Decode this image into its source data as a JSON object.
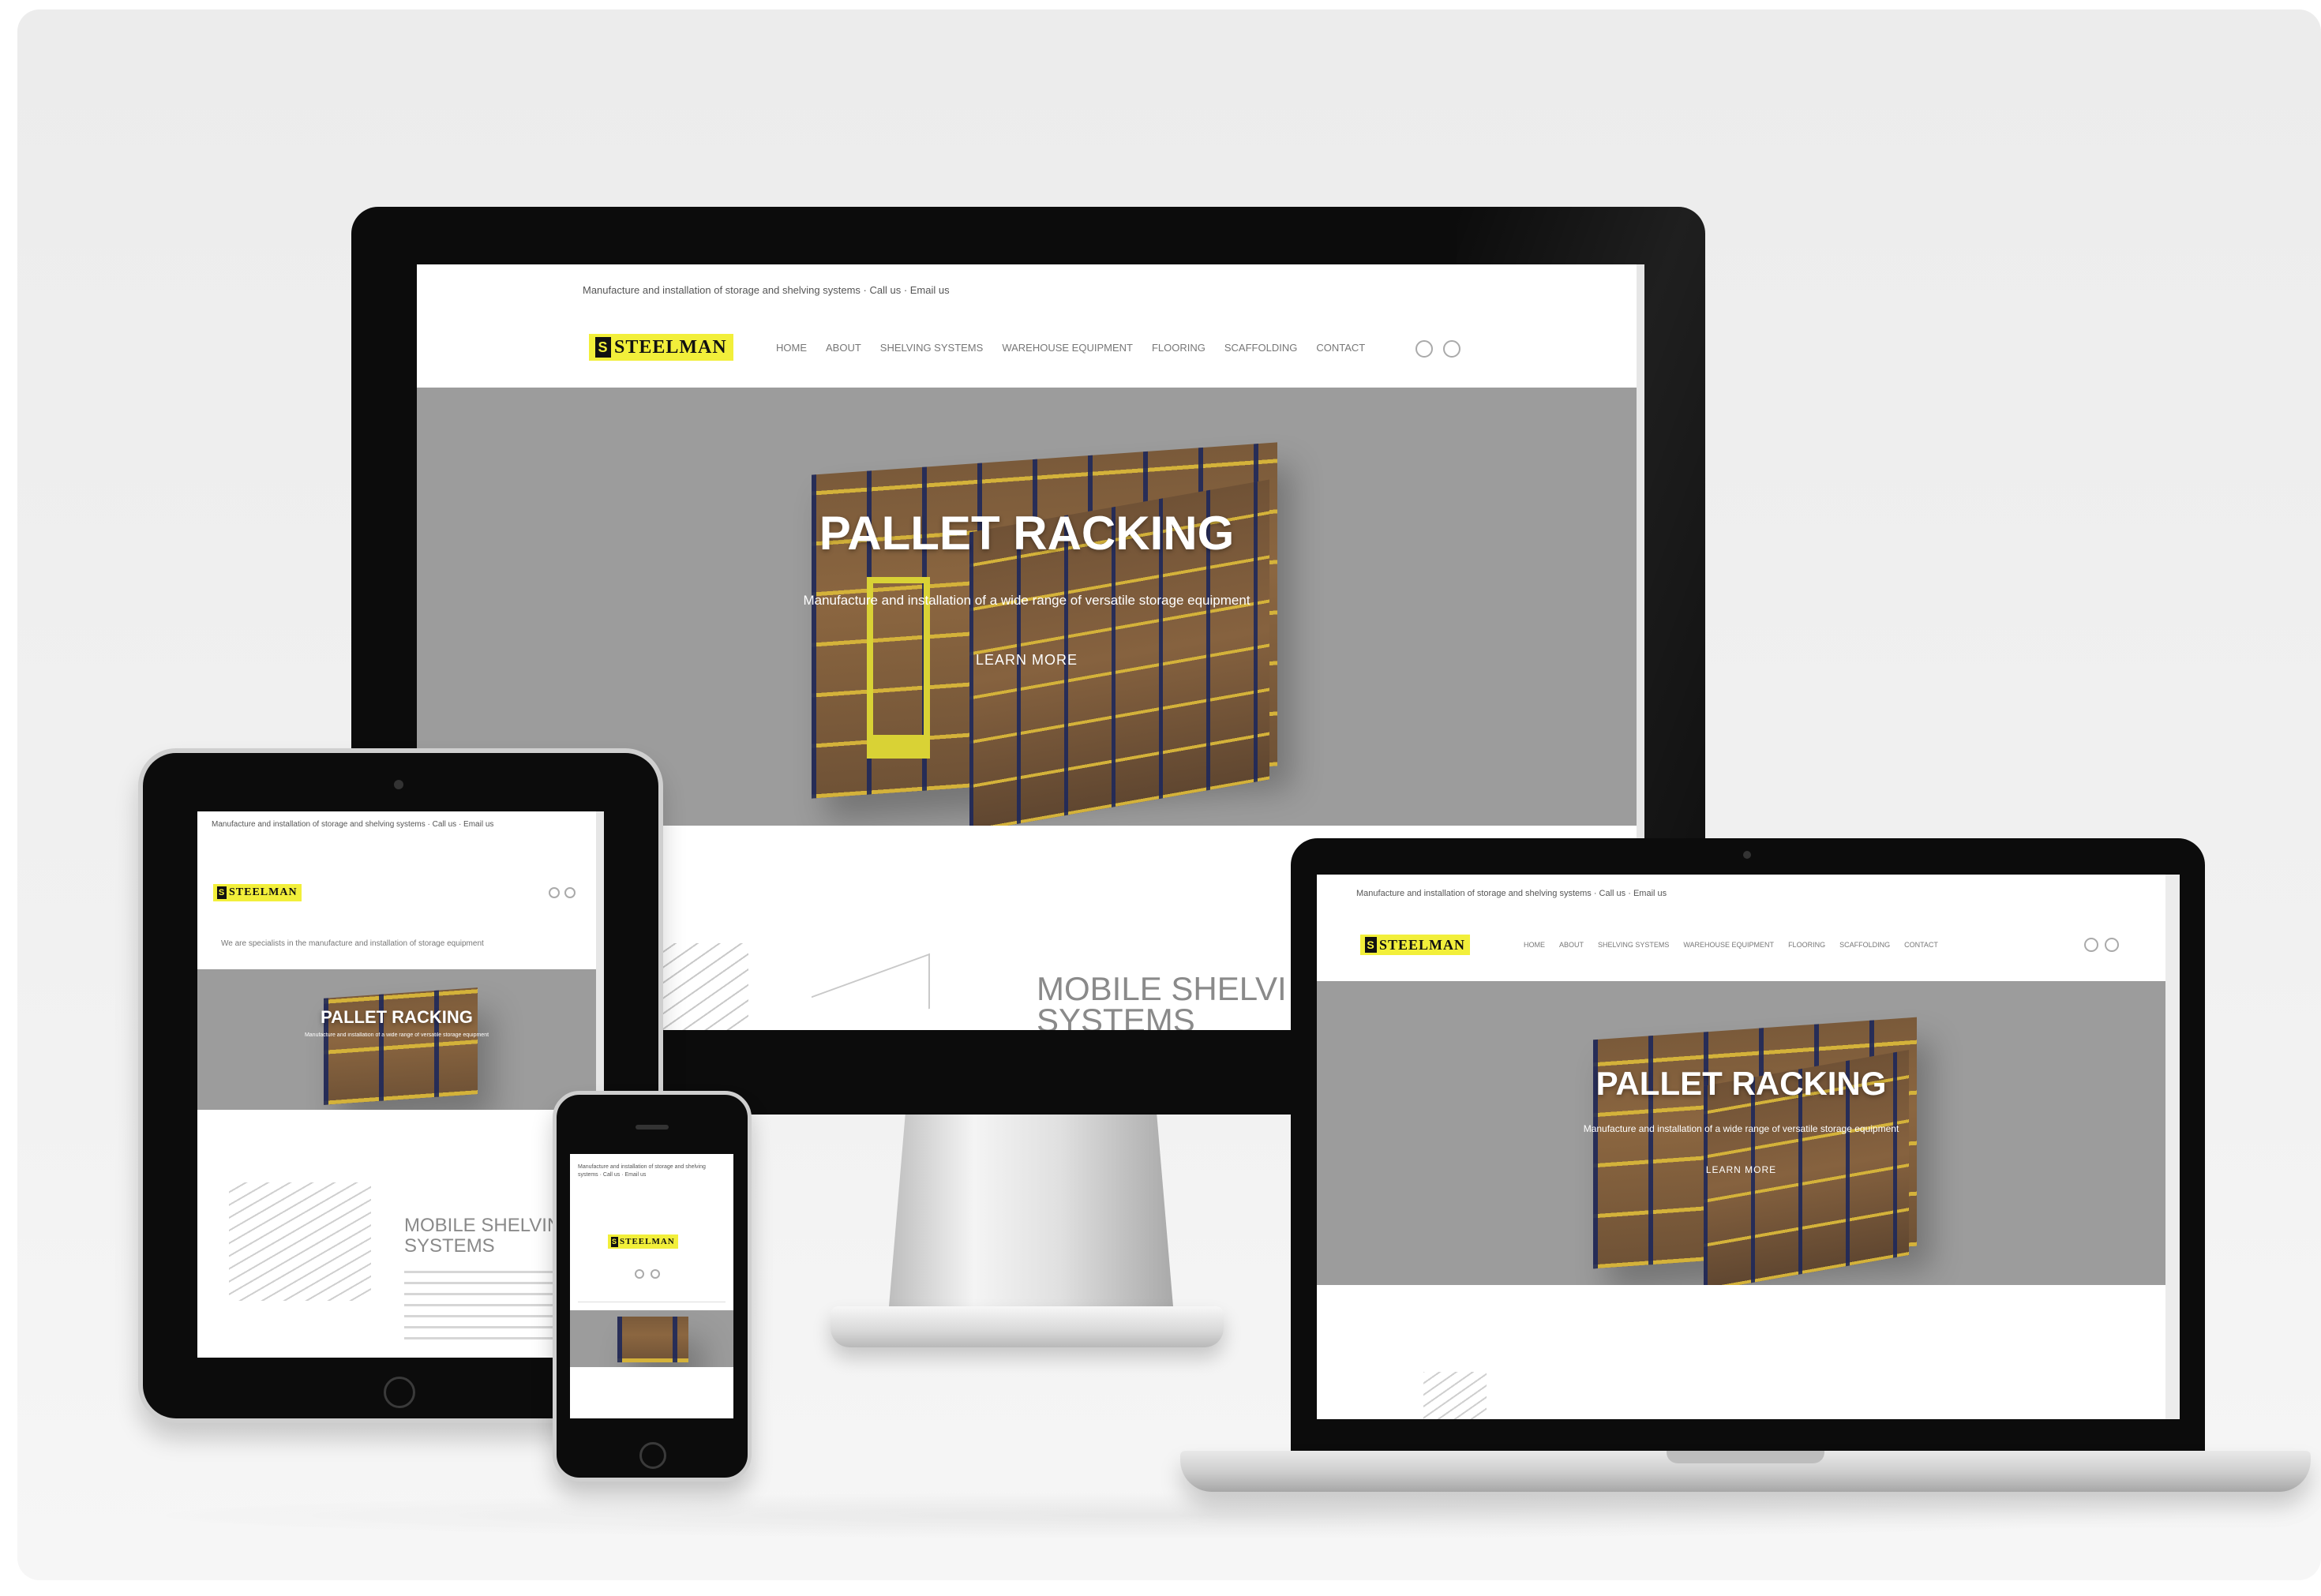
{
  "colors": {
    "accent_yellow": "#f2ef3a",
    "hero_gray": "#9c9c9c",
    "bezel": "#0c0c0c",
    "background": "#ececec"
  },
  "site": {
    "logo_text": "STEELMAN",
    "topbar_text": "Manufacture and installation of storage and shelving systems · Call us · Email us",
    "nav": [
      "HOME",
      "ABOUT",
      "SHELVING SYSTEMS",
      "WAREHOUSE EQUIPMENT",
      "FLOORING",
      "SCAFFOLDING",
      "CONTACT"
    ],
    "hero_title": "PALLET RACKING",
    "hero_subtitle": "Manufacture and installation of a wide range of versatile storage equipment",
    "hero_button": "LEARN MORE",
    "section_title_line1": "MOBILE SHELVING",
    "section_title_line2": "SYSTEMS",
    "tablet_section_line1": "MOBILE SHELVING",
    "tablet_section_line2": "SYSTEMS",
    "tablet_tagline": "We are specialists in the manufacture and installation of storage equipment"
  },
  "icons": [
    "search-icon",
    "cart-icon",
    "monitor-icon",
    "laptop-icon",
    "tablet-icon",
    "phone-icon"
  ]
}
